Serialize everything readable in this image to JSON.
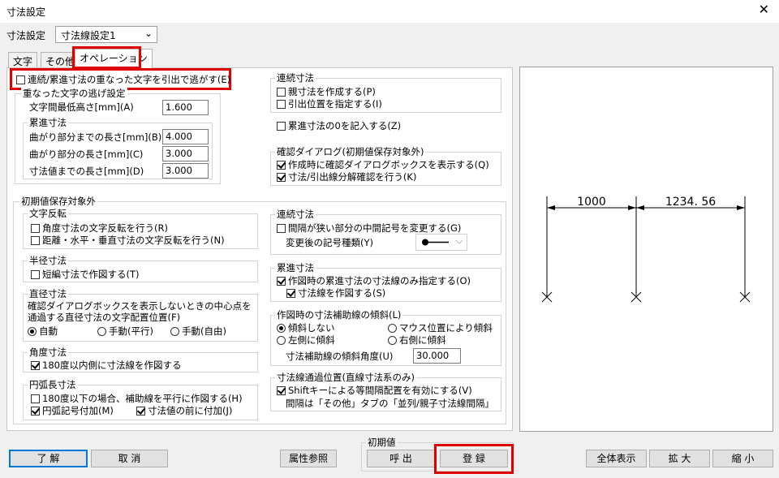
{
  "window": {
    "title": "寸法設定",
    "close": "✕"
  },
  "setting": {
    "label": "寸法設定",
    "value": "寸法線設定1"
  },
  "tabs": [
    "文字",
    "その他",
    "オペレーション"
  ],
  "left": {
    "lead_check": "連続/累進寸法の重なった文字を引出で逃がす(E)",
    "escape_group": {
      "title": "重なった文字の逃げ設定",
      "min_height_label": "文字間最低高さ[mm](A)",
      "min_height": "1.600",
      "cumul_title": "累進寸法",
      "rows": [
        {
          "label": "曲がり部分までの長さ[mm](B)",
          "value": "4.000"
        },
        {
          "label": "曲がり部分の長さ[mm](C)",
          "value": "3.000"
        },
        {
          "label": "寸法値までの長さ[mm](D)",
          "value": "3.000"
        }
      ]
    },
    "init_title": "初期値保存対象外",
    "text_reverse": {
      "title": "文字反転",
      "items": [
        "角度寸法の文字反転を行う(R)",
        "距離・水平・垂直寸法の文字反転を行う(N)"
      ]
    },
    "radius": {
      "title": "半径寸法",
      "item": "短編寸法で作図する(T)"
    },
    "diameter": {
      "title": "直径寸法",
      "desc1": "確認ダイアログボックスを表示しないときの中心点を",
      "desc2": "通過する直径寸法の文字配置位置(F)",
      "options": [
        "自動",
        "手動(平行)",
        "手動(自由)"
      ]
    },
    "angle": {
      "title": "角度寸法",
      "item": "180度以内側に寸法線を作図する"
    },
    "arc": {
      "title": "円弧長寸法",
      "item1": "180度以下の場合、補助線を平行に作図する(H)",
      "item2": "円弧記号付加(M)",
      "item3": "寸法値の前に付加(J)"
    }
  },
  "right": {
    "continuous": {
      "title": "連続寸法",
      "items": [
        "親寸法を作成する(P)",
        "引出位置を指定する(I)"
      ]
    },
    "cumul_zero": "累進寸法の0を記入する(Z)",
    "confirm": {
      "title": "確認ダイアログ(初期値保存対象外)",
      "items": [
        "作成時に確認ダイアログボックスを表示する(Q)",
        "寸法/引出線分解確認を行う(K)"
      ]
    },
    "cont2": {
      "title": "連続寸法",
      "item": "間隔が狭い部分の中間記号を変更する(G)",
      "symbol_label": "変更後の記号種類(Y)"
    },
    "cumul2": {
      "title": "累進寸法",
      "item1": "作図時の累進寸法の寸法線のみ指定する(O)",
      "item2": "寸法線を作図する(S)"
    },
    "tilt": {
      "title": "作図時の寸法補助線の傾斜(L)",
      "options": [
        "傾斜しない",
        "マウス位置により傾斜",
        "左側に傾斜",
        "右側に傾斜"
      ],
      "angle_label": "寸法補助線の傾斜角度(U)",
      "angle": "30.000"
    },
    "pass": {
      "title": "寸法線通過位置(直線寸法系のみ)",
      "item": "Shiftキーによる等間隔配置を有効にする(V)",
      "note": "間隔は「その他」タブの「並列/親子寸法線間隔」"
    }
  },
  "preview": {
    "dim1": "1000",
    "dim2": "1234. 56"
  },
  "buttons": {
    "ok": "了 解",
    "cancel": "取 消",
    "attr": "属性参照",
    "init_title": "初期値",
    "call": "呼 出",
    "register": "登 録",
    "fit": "全体表示",
    "zoom_in": "拡 大",
    "zoom_out": "縮 小"
  }
}
